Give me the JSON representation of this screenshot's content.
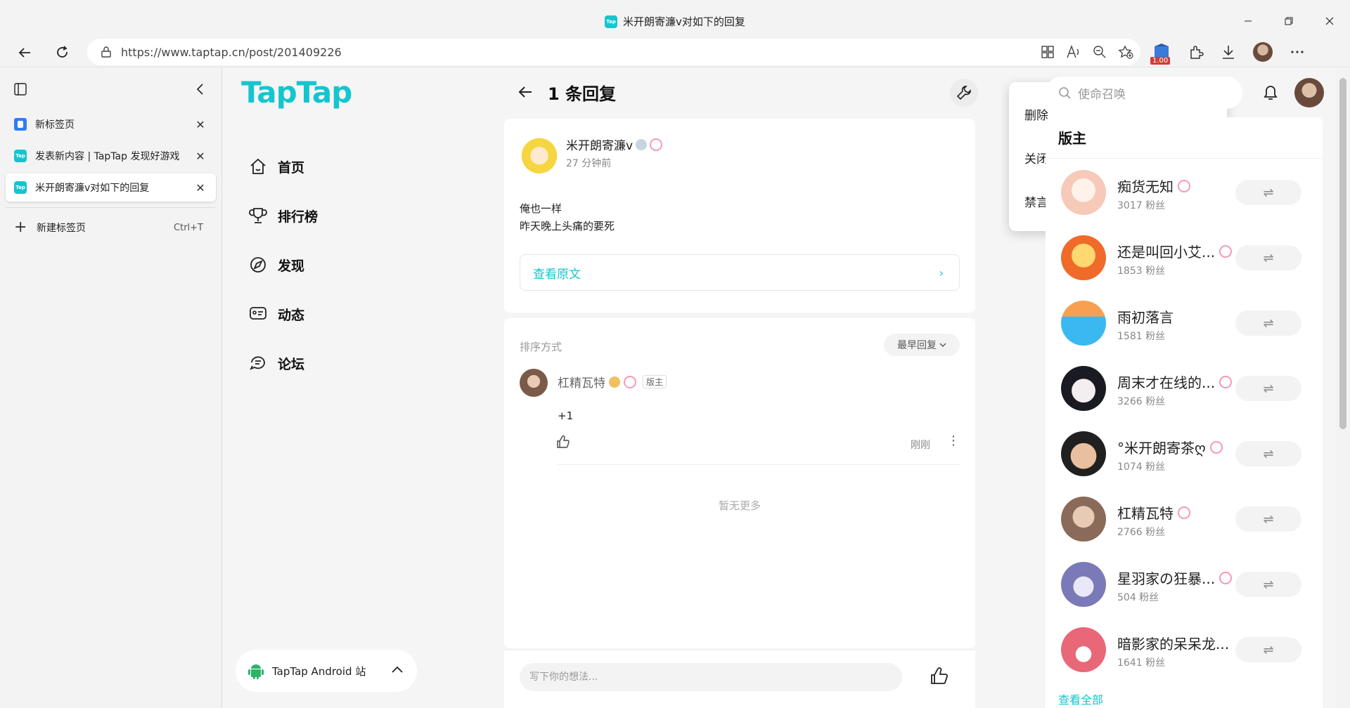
{
  "browser": {
    "tab_title": "米开朗寄濂v对如下的回复",
    "url": "https://www.taptap.cn/post/201409226",
    "ext_badge": "1.00",
    "tabs": [
      {
        "label": "新标签页",
        "favicon": "newtab"
      },
      {
        "label": "发表新内容 | TapTap 发现好游戏",
        "favicon": "tap"
      },
      {
        "label": "米开朗寄濂v对如下的回复",
        "favicon": "tap",
        "active": true
      }
    ],
    "new_tab_label": "新建标签页",
    "new_tab_shortcut": "Ctrl+T",
    "favicon_text": "Tap"
  },
  "site": {
    "logo": "TapTap",
    "nav": [
      {
        "label": "首页",
        "icon": "home-icon"
      },
      {
        "label": "排行榜",
        "icon": "trophy-icon"
      },
      {
        "label": "发现",
        "icon": "discover-icon"
      },
      {
        "label": "动态",
        "icon": "feed-icon"
      },
      {
        "label": "论坛",
        "icon": "forum-icon"
      }
    ],
    "android_label": "TapTap Android 站"
  },
  "post": {
    "title": "1 条回复",
    "author_name": "米开朗寄濂v",
    "author_time": "27 分钟前",
    "body_lines": [
      "俺也一样",
      "昨天晚上头痛的要死"
    ],
    "view_original": "查看原文",
    "sort_label": "排序方式",
    "sort_value": "最早回复",
    "reply": {
      "name": "杠精瓦特",
      "tag": "版主",
      "text": "+1",
      "time": "刚刚"
    },
    "no_more": "暂无更多",
    "comment_placeholder": "写下你的想法..."
  },
  "menu": {
    "items": [
      "删除",
      "关闭回复",
      "禁言该用户"
    ]
  },
  "sidebar": {
    "search_placeholder": "使命召唤",
    "mod_title": "版主",
    "mods": [
      {
        "name": "痴货无知",
        "fans": "3017 粉丝",
        "color": "#f6c9b8"
      },
      {
        "name": "还是叫回小艾...",
        "fans": "1853 粉丝",
        "color": "#f06a2a"
      },
      {
        "name": "雨初落言",
        "fans": "1581 粉丝",
        "color": "#3ab8f0"
      },
      {
        "name": "周末才在线的...",
        "fans": "3266 粉丝",
        "color": "#d8d8e8"
      },
      {
        "name": "°米开朗寄茶ღ",
        "fans": "1074 粉丝",
        "color": "#e8c0a0"
      },
      {
        "name": "杠精瓦特",
        "fans": "2766 粉丝",
        "color": "#8a6a58"
      },
      {
        "name": "星羽家の狂暴...",
        "fans": "504 粉丝",
        "color": "#7a7ab8"
      },
      {
        "name": "暗影家的呆呆龙...",
        "fans": "1641 粉丝",
        "color": "#e86878"
      }
    ],
    "follow_symbol": "⇌",
    "view_all": "查看全部"
  },
  "colors": {
    "brand": "#15c5ce"
  }
}
